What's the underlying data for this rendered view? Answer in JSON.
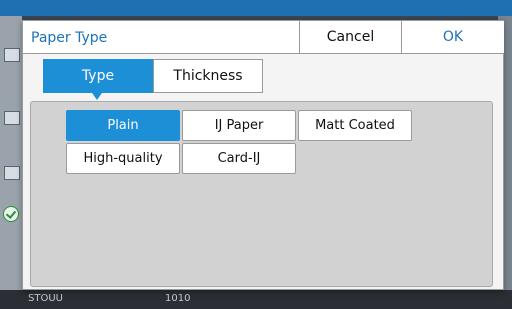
{
  "background": {
    "bottom_left": "STOUU",
    "bottom_mid": "1010"
  },
  "dialog": {
    "title": "Paper Type",
    "cancel_label": "Cancel",
    "ok_label": "OK",
    "tabs": [
      {
        "label": "Type",
        "active": true
      },
      {
        "label": "Thickness",
        "active": false
      }
    ],
    "options": [
      {
        "label": "Plain",
        "selected": true
      },
      {
        "label": "IJ Paper",
        "selected": false
      },
      {
        "label": "Matt Coated",
        "selected": false
      },
      {
        "label": "High-quality",
        "selected": false
      },
      {
        "label": "Card-IJ",
        "selected": false
      }
    ]
  },
  "colors": {
    "accent": "#1d8fd6",
    "title_blue": "#1e72b8",
    "panel_bg": "#d2d2d2"
  }
}
